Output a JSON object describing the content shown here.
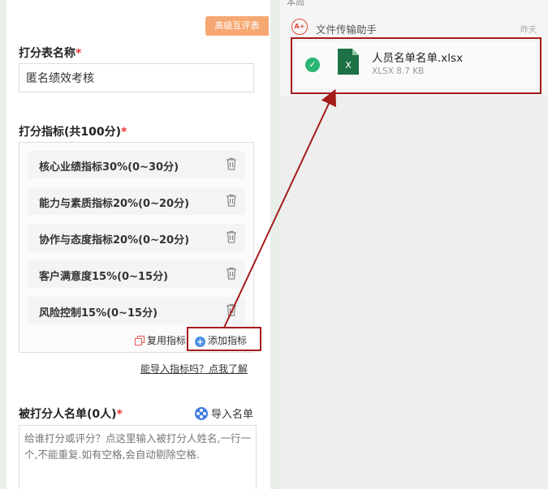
{
  "left_form": {
    "advanced_button": "高级互评表",
    "sheet_name_label": "打分表名称",
    "required_mark": "*",
    "sheet_name_value": "匿名绩效考核",
    "metrics_label": "打分指标(共100分)",
    "metrics": [
      {
        "label": "核心业绩指标30%(0~30分)"
      },
      {
        "label": "能力与素质指标20%(0~20分)"
      },
      {
        "label": "协作与态度指标20%(0~20分)"
      },
      {
        "label": "客户满意度15%(0~15分)"
      },
      {
        "label": "风险控制15%(0~15分)"
      }
    ],
    "reuse_label": "复用指标",
    "add_label": "添加指标",
    "help_link": "能导入指标吗？点我了解",
    "rated_label": "被打分人名单(0人)",
    "import_label": "导入名单",
    "textarea_placeholder": "给谁打分或评分？点这里输入被打分人姓名,一行一个,不能重复.如有空格,会自动剔除空格."
  },
  "right_chat": {
    "top_cut_text": "本周",
    "sender_name": "文件传输助手",
    "sender_time": "昨天",
    "avatar_text": "A+",
    "file": {
      "name": "人员名单名单.xlsx",
      "meta": "XLSX 8.7 KB",
      "icon": "excel-file-icon",
      "icon_letter": "X"
    }
  },
  "colors": {
    "accent_orange": "#f6a873",
    "highlight_red": "#a51c1c",
    "excel_green": "#1e7145",
    "check_green": "#2bb673",
    "link_blue": "#3d7be0"
  }
}
